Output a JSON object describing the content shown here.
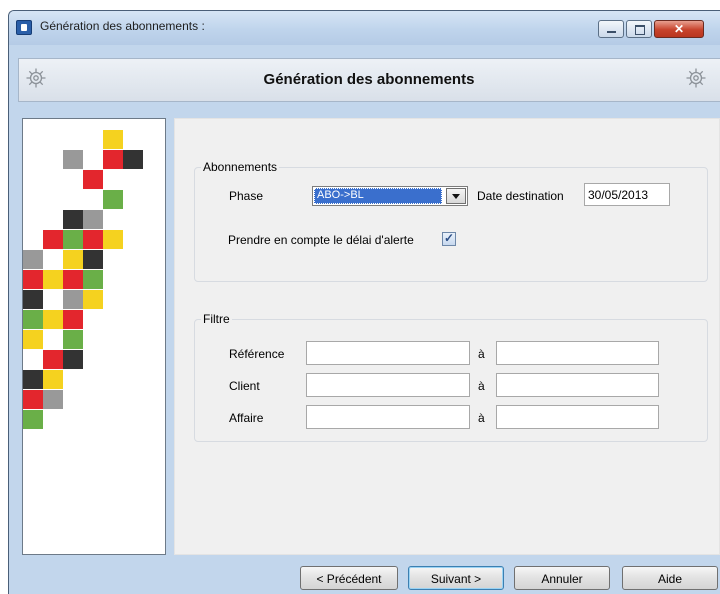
{
  "window": {
    "title": "Génération des abonnements :",
    "close_glyph": "✕"
  },
  "header": {
    "title": "Génération des abonnements"
  },
  "abonnements": {
    "legend": "Abonnements",
    "phase_label": "Phase",
    "phase_value": "ABO->BL",
    "date_label": "Date destination",
    "date_value": "30/05/2013",
    "alert_label": "Prendre en compte le délai d'alerte",
    "alert_checked": true,
    "check_glyph": "✓"
  },
  "filtre": {
    "legend": "Filtre",
    "to_label": "à",
    "rows": [
      {
        "label": "Référence",
        "from": "",
        "to": ""
      },
      {
        "label": "Client",
        "from": "",
        "to": ""
      },
      {
        "label": "Affaire",
        "from": "",
        "to": ""
      }
    ]
  },
  "buttons": {
    "previous": "< Précédent",
    "next": "Suivant >",
    "cancel": "Annuler",
    "help": "Aide"
  },
  "colors": {
    "yellow": "#f5d21f",
    "red": "#e3262d",
    "gray": "#999999",
    "dark": "#333333",
    "green": "#6aaf48"
  },
  "logo_mosaic": [
    [
      "",
      "",
      "",
      "",
      "yellow",
      ""
    ],
    [
      "",
      "",
      "gray",
      "",
      "red",
      "dark"
    ],
    [
      "",
      "",
      "",
      "red",
      "",
      ""
    ],
    [
      "",
      "",
      "",
      "",
      "green",
      ""
    ],
    [
      "",
      "",
      "dark",
      "gray",
      "",
      ""
    ],
    [
      "",
      "red",
      "green",
      "red",
      "yellow",
      ""
    ],
    [
      "gray",
      "",
      "yellow",
      "dark",
      "",
      ""
    ],
    [
      "red",
      "yellow",
      "red",
      "green",
      "",
      ""
    ],
    [
      "dark",
      "",
      "gray",
      "yellow",
      "",
      ""
    ],
    [
      "green",
      "yellow",
      "red",
      "",
      "",
      ""
    ],
    [
      "yellow",
      "",
      "green",
      "",
      "",
      ""
    ],
    [
      "",
      "red",
      "dark",
      "",
      "",
      ""
    ],
    [
      "dark",
      "yellow",
      "",
      "",
      "",
      ""
    ],
    [
      "red",
      "gray",
      "",
      "",
      "",
      ""
    ],
    [
      "green",
      "",
      "",
      "",
      "",
      ""
    ]
  ]
}
